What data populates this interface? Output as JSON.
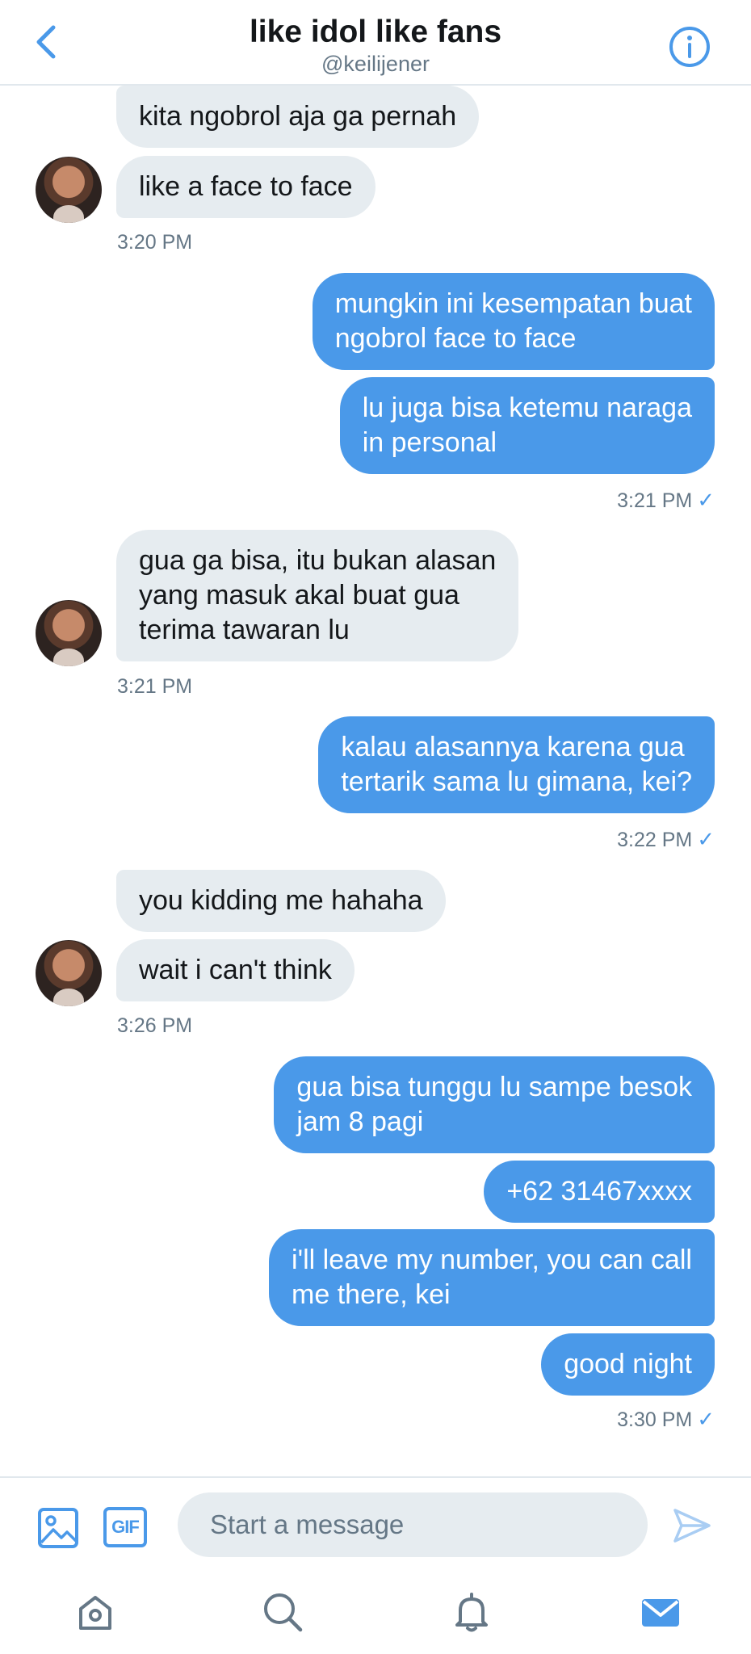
{
  "header": {
    "back_icon": "chevron-left-icon",
    "title": "like idol like fans",
    "handle": "@keilijener",
    "info_icon": "info-icon"
  },
  "messages": [
    {
      "side": "in",
      "text": "kita ngobrol aja ga pernah"
    },
    {
      "side": "in",
      "text": "like a face to face"
    },
    {
      "time": "3:20 PM"
    },
    {
      "side": "out",
      "line1": "mungkin ini kesempatan buat",
      "line2": "ngobrol face to face"
    },
    {
      "side": "out",
      "line1": "lu juga bisa ketemu naraga",
      "line2": "in personal"
    },
    {
      "time": "3:21 PM"
    },
    {
      "side": "in",
      "line1": "gua ga bisa, itu bukan alasan",
      "line2": "yang masuk akal buat gua",
      "line3": "terima tawaran lu"
    },
    {
      "time": "3:21 PM"
    },
    {
      "side": "out",
      "line1": "kalau alasannya karena gua",
      "line2": "tertarik sama lu gimana, kei?"
    },
    {
      "time": "3:22 PM"
    },
    {
      "side": "in",
      "text": "you kidding me hahaha"
    },
    {
      "side": "in",
      "text": "wait i can't think"
    },
    {
      "time": "3:26 PM"
    },
    {
      "side": "out",
      "line1": "gua bisa tunggu lu sampe besok",
      "line2": "jam 8 pagi"
    },
    {
      "side": "out",
      "text": "+62 31467xxxx"
    },
    {
      "side": "out",
      "line1": "i'll leave my number, you can call",
      "line2": "me there, kei"
    },
    {
      "side": "out",
      "text": "good night"
    },
    {
      "time": "3:30 PM"
    }
  ],
  "read_check": "✓",
  "composer": {
    "media_icon": "image-icon",
    "gif_label": "GIF",
    "placeholder": "Start a message",
    "send_icon": "send-icon"
  },
  "tabbar": {
    "items": [
      "home-icon",
      "search-icon",
      "notifications-icon",
      "messages-icon"
    ],
    "active": "messages-icon"
  },
  "colors": {
    "accent": "#4a99e9",
    "incoming_bubble": "#e6ecf0",
    "meta_text": "#657786"
  }
}
